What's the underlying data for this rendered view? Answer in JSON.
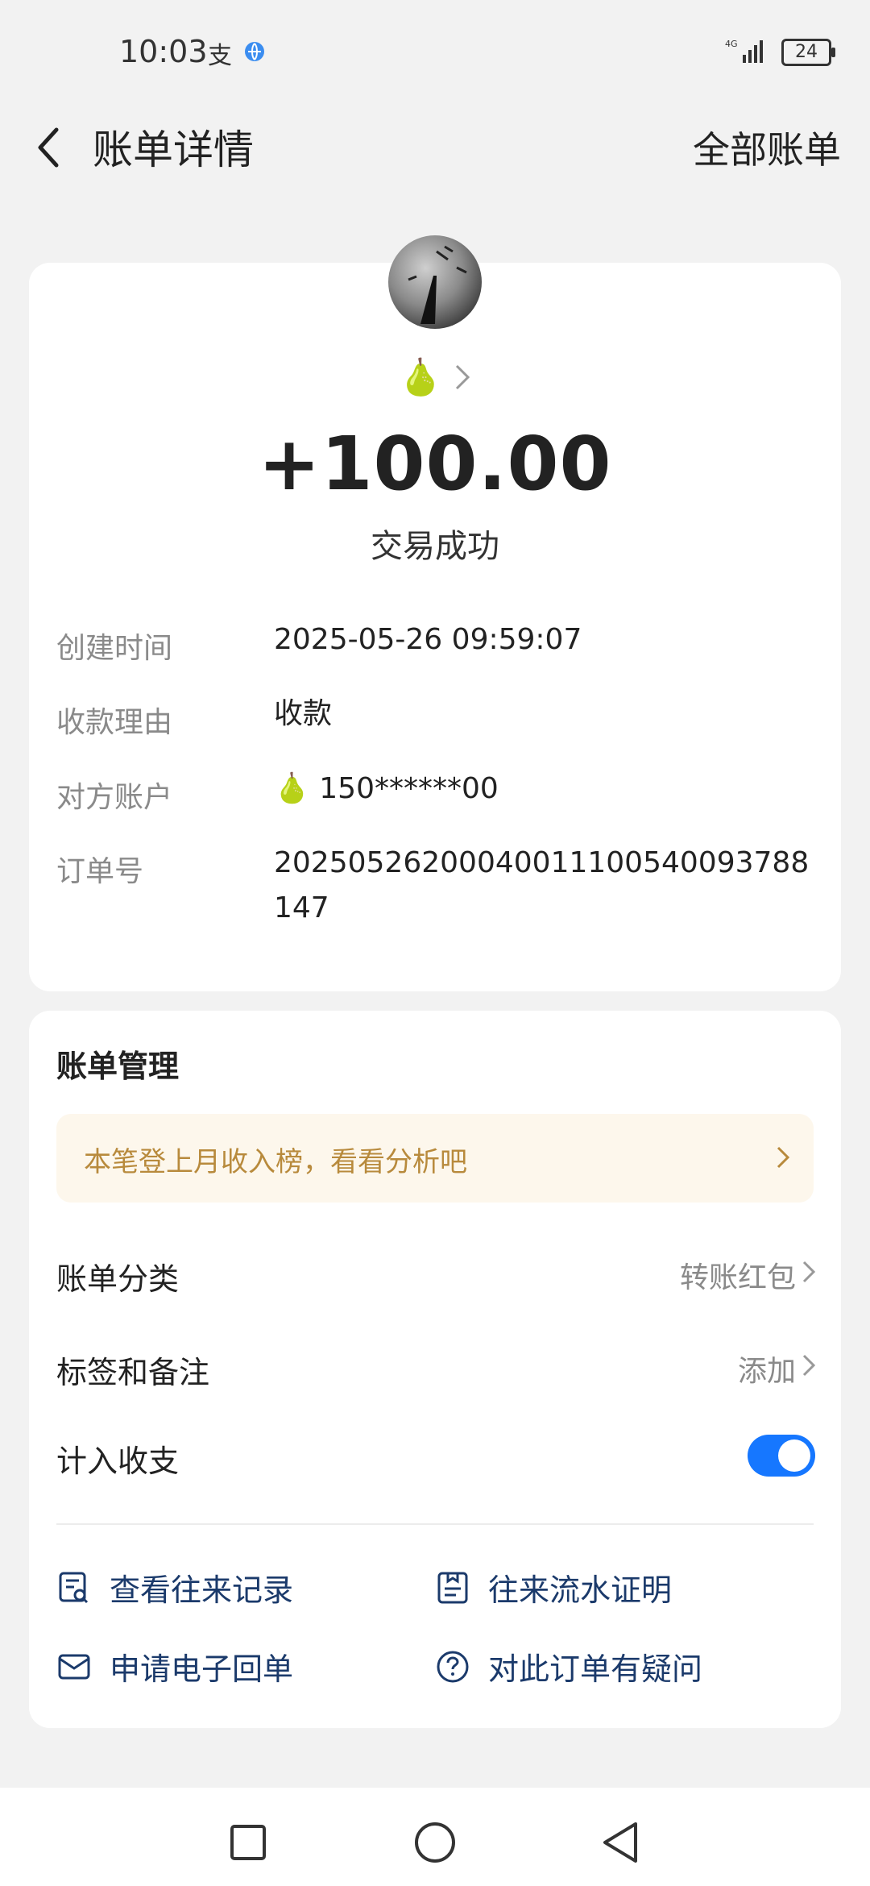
{
  "status_bar": {
    "time": "10:03",
    "battery": "24",
    "network": "4G"
  },
  "header": {
    "title": "账单详情",
    "all_bills": "全部账单"
  },
  "summary": {
    "name_emoji": "🍐",
    "amount": "+100.00",
    "status": "交易成功"
  },
  "details": [
    {
      "label": "创建时间",
      "value": "2025-05-26 09:59:07"
    },
    {
      "label": "收款理由",
      "value": "收款"
    },
    {
      "label": "对方账户",
      "value": "🍐 150******00"
    },
    {
      "label": "订单号",
      "value": "20250526200040011100540093788147"
    }
  ],
  "manage": {
    "title": "账单管理",
    "promo": "本笔登上月收入榜，看看分析吧",
    "category_label": "账单分类",
    "category_value": "转账红包",
    "tags_label": "标签和备注",
    "tags_value": "添加",
    "count_label": "计入收支",
    "count_enabled": true,
    "actions": [
      {
        "label": "查看往来记录",
        "icon": "record-search-icon"
      },
      {
        "label": "往来流水证明",
        "icon": "statement-icon"
      },
      {
        "label": "申请电子回单",
        "icon": "mail-icon"
      },
      {
        "label": "对此订单有疑问",
        "icon": "question-icon"
      }
    ]
  },
  "colors": {
    "accent": "#1677ff",
    "promo_text": "#b88a3c",
    "promo_bg": "#fdf7ec",
    "action_text": "#1b3a6b"
  }
}
